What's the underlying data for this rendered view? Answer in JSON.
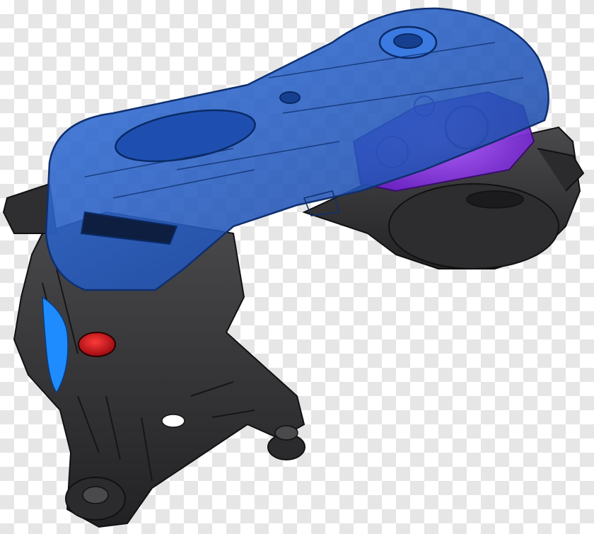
{
  "image": {
    "subject": "",
    "colors": {
      "housing": "#3a3a3c",
      "housing_dark": "#1f1f21",
      "housing_edge": "#111113",
      "cover_blue": "#2a62c9",
      "cover_edge": "#0f2f6e",
      "inner_purple": "#8a2be2",
      "red_port": "#c8101a",
      "cyan_part": "#1e8cff"
    }
  }
}
